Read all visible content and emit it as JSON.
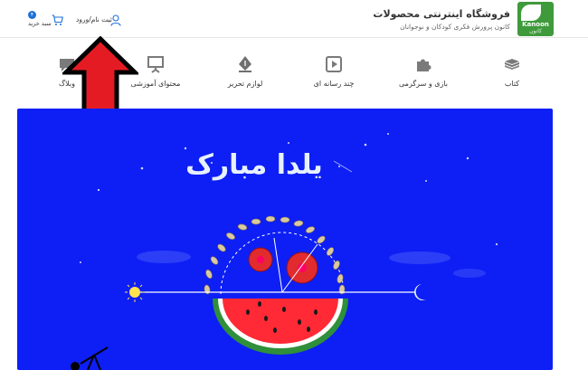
{
  "header": {
    "logo_word": "Kanoon",
    "logo_word_fa": "کانون",
    "site_title": "فروشگاه اینترنتی محصولات",
    "site_subtitle": "کانون پرورش فکری کودکان و نوجوانان",
    "login_label": "ثبت نام/ورود",
    "cart_label": "سبد خرید",
    "cart_count": "۴"
  },
  "categories": [
    {
      "label": "کتاب",
      "icon": "books-icon"
    },
    {
      "label": "بازی و سرگرمی",
      "icon": "puzzle-icon"
    },
    {
      "label": "چند رسانه ای",
      "icon": "media-play-icon"
    },
    {
      "label": "لوازم تحریر",
      "icon": "pen-nib-icon"
    },
    {
      "label": "محتوای آموزشی",
      "icon": "presentation-icon"
    },
    {
      "label": "وبلاگ",
      "icon": "chat-icon"
    }
  ],
  "banner": {
    "headline": "یلدا مبارک",
    "bg": "#0d1ff5"
  },
  "colors": {
    "accent": "#1c6fd8",
    "logo_green": "#3f9a3b",
    "arrow_red": "#e51b23"
  }
}
